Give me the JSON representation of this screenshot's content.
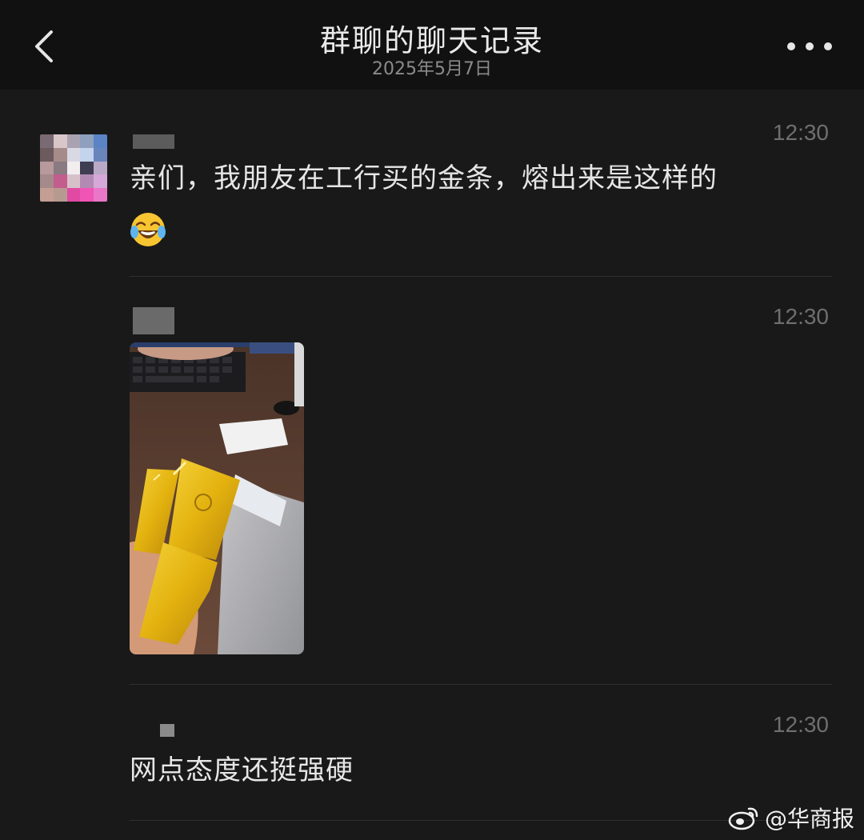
{
  "header": {
    "title": "群聊的聊天记录",
    "date": "2025年5月7日",
    "back_icon": "chevron-left-icon",
    "more_icon": "more-dots-icon"
  },
  "messages": [
    {
      "time": "12:30",
      "text": "亲们，我朋友在工行买的金条，熔出来是这样的",
      "emoji": "tears-of-joy-emoji"
    },
    {
      "time": "12:30",
      "image": "gold-bars-photo"
    },
    {
      "time": "12:30",
      "text": "网点态度还挺强硬"
    }
  ],
  "watermark": {
    "text": "@华商报",
    "icon": "weibo-icon"
  },
  "colors": {
    "background": "#191919",
    "header_bg": "#111111",
    "text": "#e6e6e6",
    "timestamp": "#6f6f6f",
    "gold": "#e6b817"
  }
}
